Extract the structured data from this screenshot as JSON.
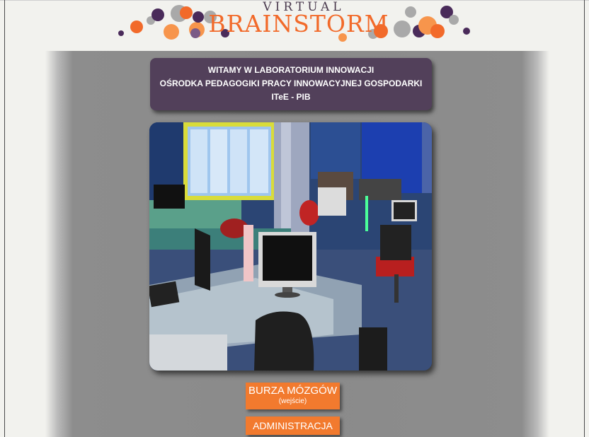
{
  "header": {
    "logo_top": "VIRTUAL",
    "logo_main": "BRAINSTORM"
  },
  "welcome": {
    "line1": "WITAMY W LABORATORIUM INNOWACJI",
    "line2": "OŚRODKA PEDAGOGIKI PRACY INNOWACYJNEJ GOSPODARKI",
    "line3": "ITeE - PIB"
  },
  "buttons": {
    "main_label": "BURZA MÓZGÓW",
    "main_sublabel": "(wejście)",
    "admin_label": "ADMINISTRACJA"
  },
  "colors": {
    "brand_orange": "#f26a2a",
    "brand_purple": "#52405a",
    "page_background": "#f2f2ee",
    "band_gray": "#8a8a8a"
  }
}
